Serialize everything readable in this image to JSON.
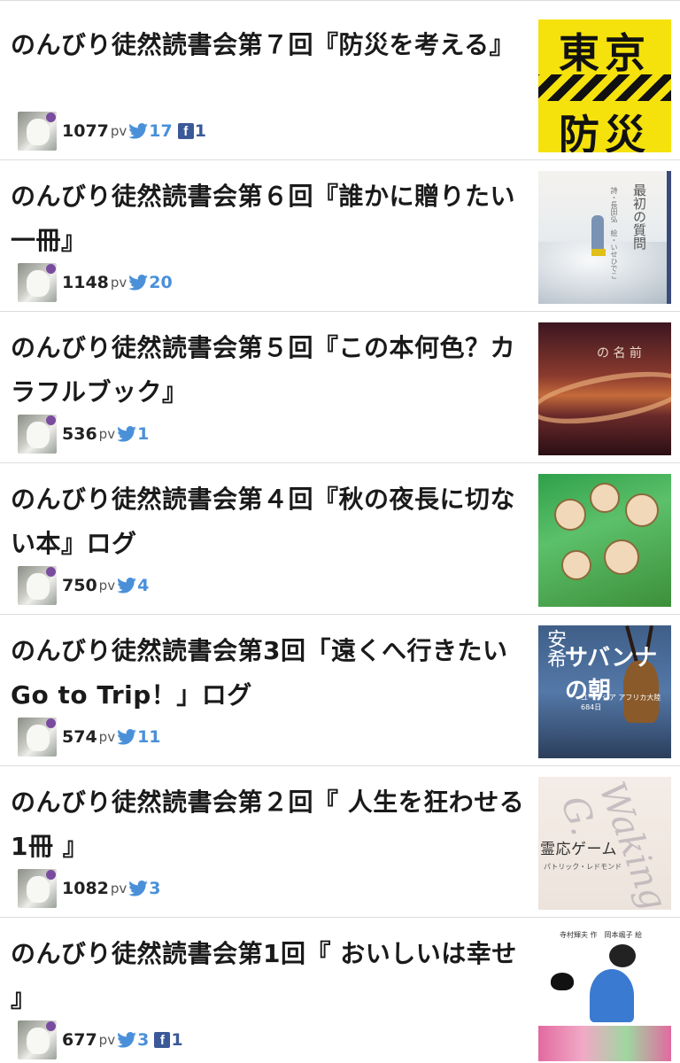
{
  "entries": [
    {
      "title": "のんびり徒然読書会第７回『防災を考える』",
      "pv": "1077",
      "pv_unit": "pv",
      "tweets": "17",
      "fb": "1",
      "fb_icon_label": "f",
      "thumb": {
        "line1": "東京",
        "line2": "防災",
        "mark": "防災"
      }
    },
    {
      "title": "のんびり徒然読書会第６回『誰かに贈りたい一冊』",
      "pv": "1148",
      "pv_unit": "pv",
      "tweets": "20",
      "fb": null,
      "fb_icon_label": null,
      "thumb": {
        "book_title": "最初の質問",
        "credit": "詩・長田弘　絵・いせひでこ"
      }
    },
    {
      "title": "のんびり徒然読書会第５回『この本何色？カラフルブック』",
      "pv": "536",
      "pv_unit": "pv",
      "tweets": "1",
      "fb": null,
      "fb_icon_label": null,
      "thumb": {
        "book_title": "の 名 前",
        "credit": ""
      }
    },
    {
      "title": "のんびり徒然読書会第４回『秋の夜長に切ない本』ログ",
      "pv": "750",
      "pv_unit": "pv",
      "tweets": "4",
      "fb": null,
      "fb_icon_label": null,
      "thumb": {}
    },
    {
      "title": "のんびり徒然読書会第3回「遠くへ行きたい Go to Trip！」ログ",
      "pv": "574",
      "pv_unit": "pv",
      "tweets": "11",
      "fb": null,
      "fb_icon_label": null,
      "thumb": {
        "author": "安希",
        "book_title": "サバンナの朝",
        "sub": "ユーラシア アフリカ大陸 684日"
      }
    },
    {
      "title": "のんびり徒然読書会第２回『 人生を狂わせる1冊 』",
      "pv": "1082",
      "pv_unit": "pv",
      "tweets": "3",
      "fb": null,
      "fb_icon_label": null,
      "thumb": {
        "script": "Waking G.",
        "book_title": "霊応ゲーム",
        "sub": "パトリック・レドモンド"
      }
    },
    {
      "title": "のんびり徒然読書会第1回『 おいしいは幸せ 』",
      "pv": "677",
      "pv_unit": "pv",
      "tweets": "3",
      "fb": "1",
      "fb_icon_label": "f",
      "thumb": {
        "credit": "寺村輝夫 作　岡本颯子 絵"
      }
    }
  ],
  "colors": {
    "twitter": "#4a90d9",
    "facebook": "#3b5998",
    "divider": "#dddddd"
  },
  "icons": {
    "avatar": "cat-avatar-icon",
    "tweet": "twitter-bird-icon",
    "facebook": "facebook-icon"
  }
}
